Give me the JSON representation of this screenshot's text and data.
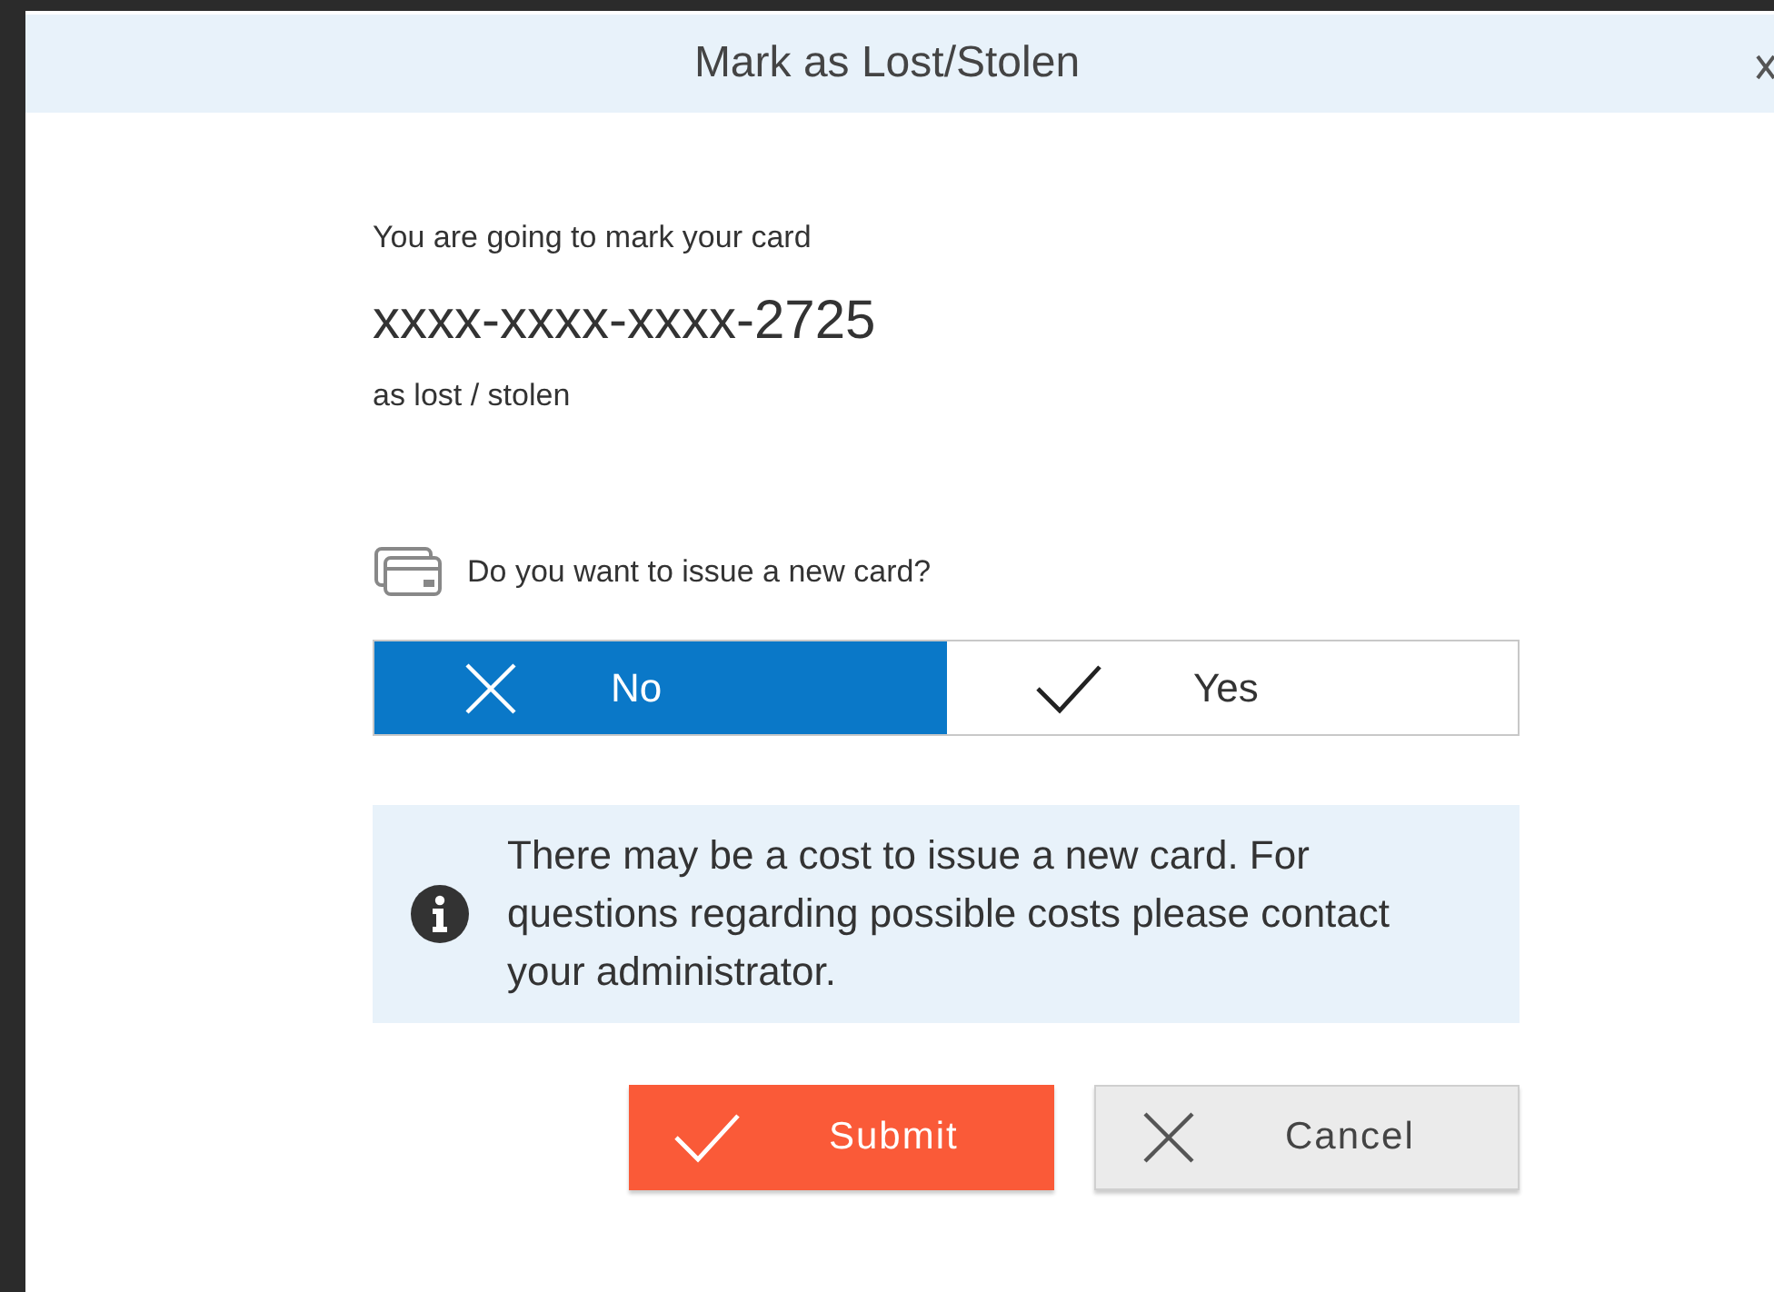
{
  "dialog": {
    "title": "Mark as Lost/Stolen"
  },
  "intro": "You are going to mark your card",
  "card_number": "xxxx-xxxx-xxxx-2725",
  "outro": "as lost / stolen",
  "question": "Do you want to issue a new card?",
  "options": [
    {
      "label": "No",
      "kind": "cross",
      "selected": true
    },
    {
      "label": "Yes",
      "kind": "check",
      "selected": false
    }
  ],
  "notice": "There may be a cost to issue a new card. For questions regarding possible costs please contact your administrator.",
  "buttons": [
    {
      "label": "Submit",
      "kind": "primary"
    },
    {
      "label": "Cancel",
      "kind": "secondary"
    }
  ]
}
